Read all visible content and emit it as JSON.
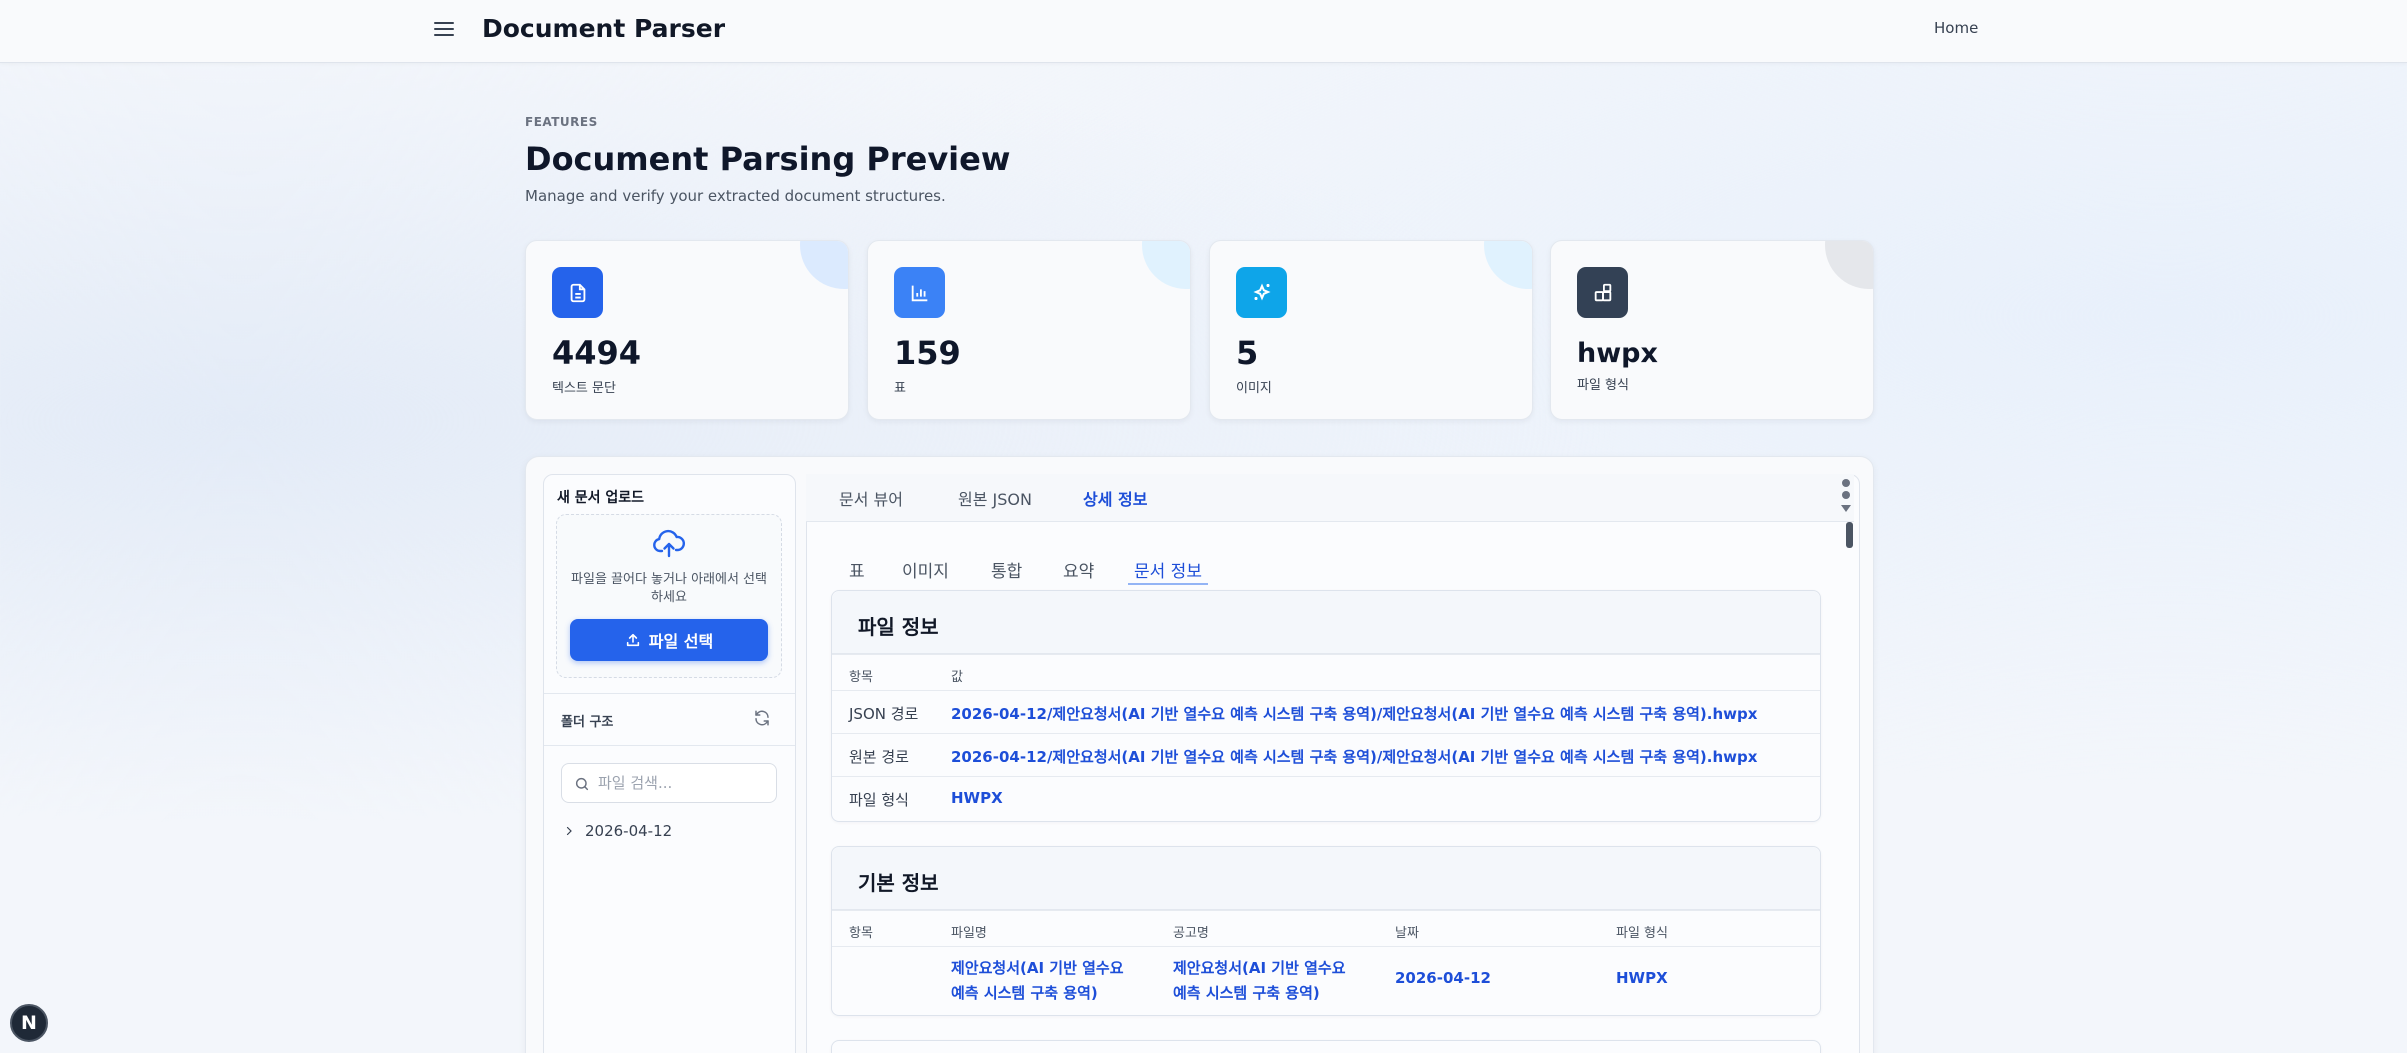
{
  "header": {
    "brand": "Document Parser",
    "nav_home": "Home"
  },
  "hero": {
    "eyebrow": "FEATURES",
    "title": "Document Parsing Preview",
    "subtitle": "Manage and verify your extracted document structures."
  },
  "stats": [
    {
      "value": "4494",
      "label": "텍스트 문단",
      "icon": "document-icon",
      "color": "#2563eb"
    },
    {
      "value": "159",
      "label": "표",
      "icon": "bar-chart-icon",
      "color": "#3b82f6"
    },
    {
      "value": "5",
      "label": "이미지",
      "icon": "sparkles-icon",
      "color": "#0ea5e9"
    },
    {
      "value": "hwpx",
      "label": "파일 형식",
      "icon": "blocks-icon",
      "color": "#334155"
    }
  ],
  "upload": {
    "title": "새 문서 업로드",
    "drop_text": "파일을 끌어다 놓거나 아래에서 선택하세요",
    "button": "파일 선택"
  },
  "folder": {
    "title": "폴더 구조",
    "search_placeholder": "파일 검색...",
    "items": [
      {
        "label": "2026-04-12"
      }
    ]
  },
  "tabs": [
    {
      "label": "문서 뷰어",
      "active": false
    },
    {
      "label": "원본 JSON",
      "active": false
    },
    {
      "label": "상세 정보",
      "active": true
    }
  ],
  "subtabs": [
    {
      "label": "표",
      "active": false
    },
    {
      "label": "이미지",
      "active": false
    },
    {
      "label": "통합",
      "active": false
    },
    {
      "label": "요약",
      "active": false
    },
    {
      "label": "문서 정보",
      "active": true
    }
  ],
  "file_info": {
    "title": "파일 정보",
    "headers": [
      "항목",
      "값"
    ],
    "rows": [
      {
        "key": "JSON 경로",
        "value": "2026-04-12/제안요청서(AI 기반 열수요 예측 시스템 구축 용역)/제안요청서(AI 기반 열수요 예측 시스템 구축 용역).hwpx"
      },
      {
        "key": "원본 경로",
        "value": "2026-04-12/제안요청서(AI 기반 열수요 예측 시스템 구축 용역)/제안요청서(AI 기반 열수요 예측 시스템 구축 용역).hwpx"
      },
      {
        "key": "파일 형식",
        "value": "HWPX"
      }
    ]
  },
  "basic_info": {
    "title": "기본 정보",
    "headers": [
      "항목",
      "파일명",
      "공고명",
      "날짜",
      "파일 형식"
    ],
    "row": {
      "filename_line1": "제안요청서(AI 기반 열수요",
      "filename_line2": "예측 시스템 구축 용역)",
      "notice_line1": "제안요청서(AI 기반 열수요",
      "notice_line2": "예측 시스템 구축 용역)",
      "date": "2026-04-12",
      "format": "HWPX"
    }
  },
  "badge": {
    "letter": "N"
  }
}
